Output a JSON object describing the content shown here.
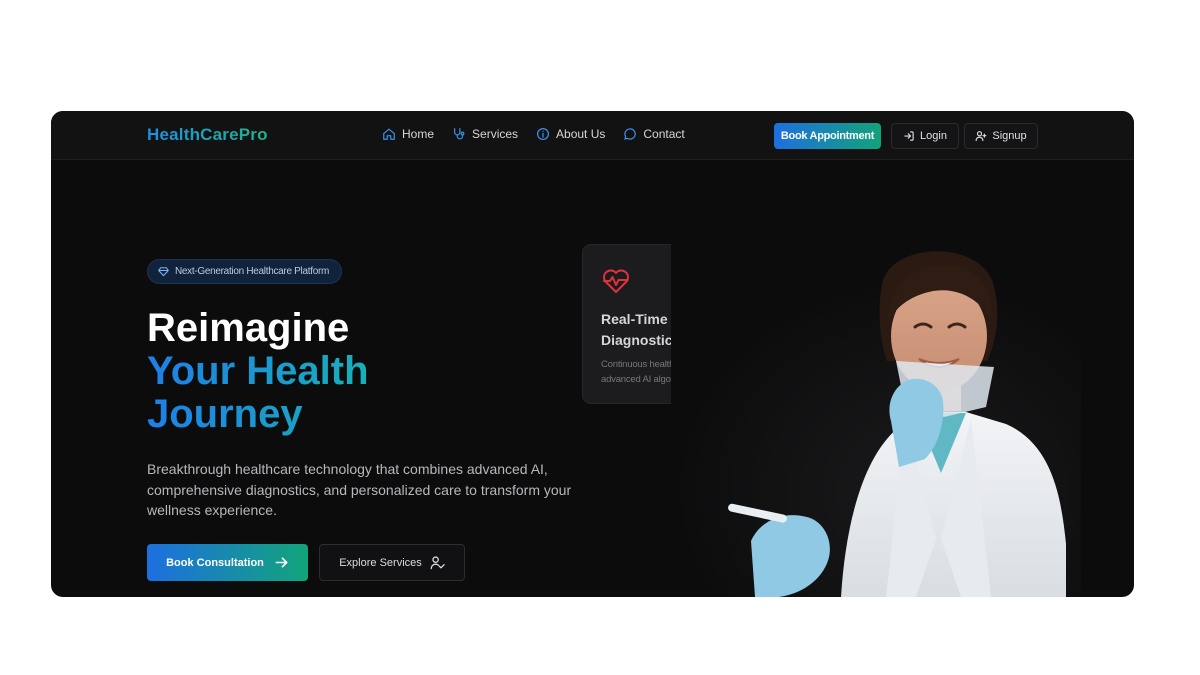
{
  "nav": {
    "logo": "HealthCarePro",
    "links": [
      {
        "label": "Home",
        "icon": "home-icon"
      },
      {
        "label": "Services",
        "icon": "stethoscope-icon"
      },
      {
        "label": "About Us",
        "icon": "info-icon"
      },
      {
        "label": "Contact",
        "icon": "chat-icon"
      }
    ],
    "book_appointment": "Book Appointment",
    "login": "Login",
    "signup": "Signup"
  },
  "hero": {
    "badge": "Next-Generation Healthcare Platform",
    "headline_line1": "Reimagine",
    "headline_line2": "Your Health",
    "headline_line3": "Journey",
    "description": "Breakthrough healthcare technology that combines advanced AI, comprehensive diagnostics, and personalized care to transform your wellness experience.",
    "primary_cta": "Book Consultation",
    "secondary_cta": "Explore Services"
  },
  "feature_card": {
    "icon": "heart-pulse-icon",
    "title": "Real-Time Diagnostics",
    "description": "Continuous health monitoring with advanced AI algorithms"
  },
  "colors": {
    "background": "#0c0c0d",
    "brand_blue": "#1e7fe8",
    "brand_green": "#13a37a",
    "heart_red": "#e0313e"
  }
}
